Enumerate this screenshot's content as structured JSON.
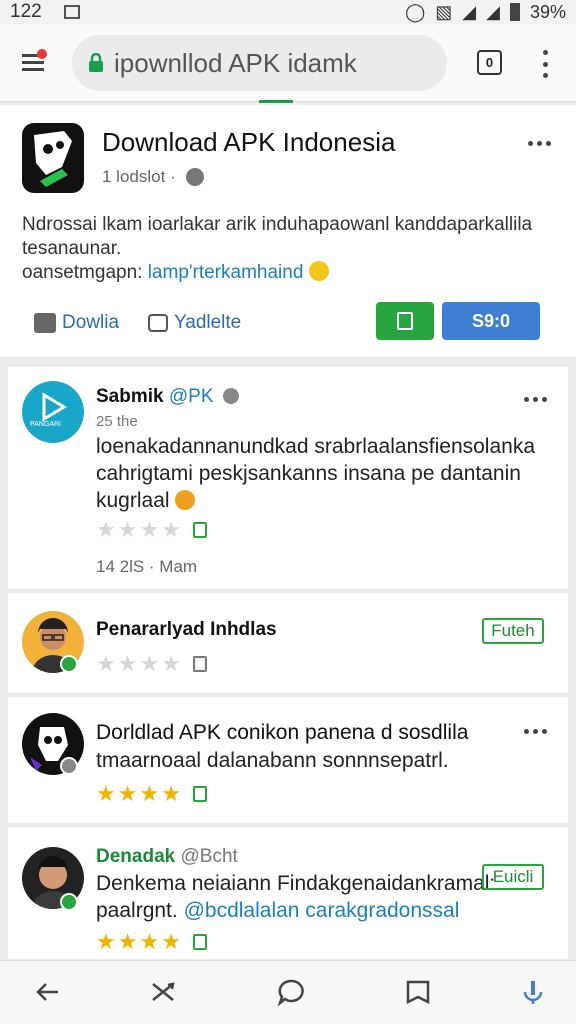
{
  "status": {
    "time": "122",
    "battery": "39%"
  },
  "browser": {
    "url": "ipownllod APK idamk",
    "tabs_count": "0"
  },
  "post": {
    "title": "Download APK Indonesia",
    "meta": "1 lodslot ·",
    "text_1": "Ndrossai lkam ioarlakar arik induhapaowanl kanddaparkallila tesanaunar.",
    "text_2": "oansetmgapn:",
    "text_link": "lamp'rterkamhaind",
    "like_label": "Dowlia",
    "comment_label": "Yadlelte",
    "blue_button": "S9:0"
  },
  "comments": [
    {
      "name": "Sabmik",
      "handle": "@PK",
      "sub": "25 the",
      "avatar_label": "PANGARI",
      "body": "loenakadannanundkad srabrlaalansfiensolanka cahrigtami peskjsankanns insana pe dantanin kugrlaal",
      "rating": 0,
      "time": "14  2lS · Mam"
    },
    {
      "name": "Penararlyad Inhdlas",
      "rating": 0,
      "follow": "Futeh"
    },
    {
      "name": "Dorldlad APK conikon panena d sosdlila",
      "body": "tmaarnoaal dalanabann sonnnsepatrl.",
      "rating": 4
    },
    {
      "name": "Denadak",
      "handle": "@Bcht",
      "body": "Denkema neiaiann Findakgenaidankramal: paalrgnt.",
      "link": "@bcdlalalan carakgradonssal",
      "rating": 4,
      "follow": "Euicli"
    }
  ],
  "colors": {
    "accent_green": "#27a53e",
    "link_blue": "#1a7fc1",
    "button_blue": "#3f7fd3",
    "star": "#f0b400"
  }
}
